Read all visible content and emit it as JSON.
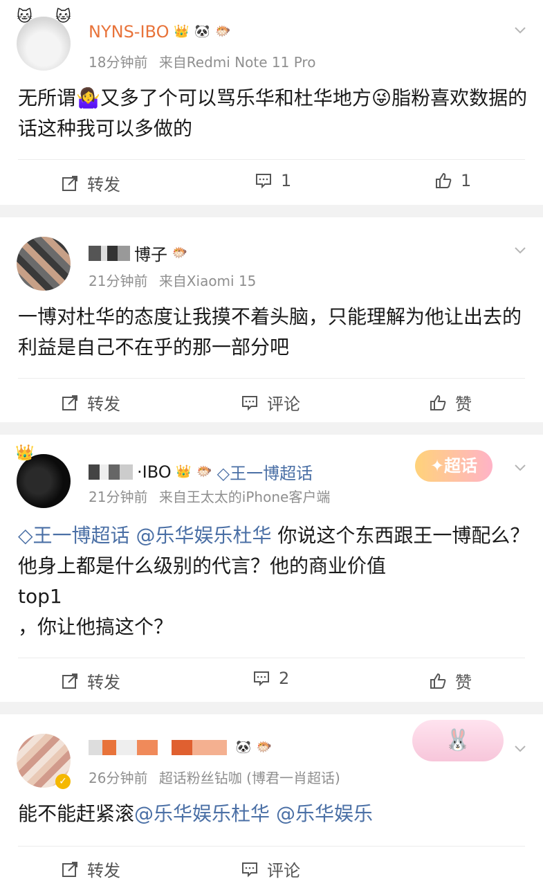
{
  "posts": [
    {
      "username": "NYNS-IBO",
      "time": "18分钟前",
      "source": "来自Redmi Note 11 Pro",
      "text_parts": [
        "无所谓",
        "🤷‍♀️",
        "又多了个可以骂乐华和杜华地方",
        "😜",
        "脂粉喜欢数据的话这种我可以多做的"
      ],
      "actions": {
        "repost": "转发",
        "comment": "1",
        "like": "1"
      }
    },
    {
      "username": "博子",
      "time": "21分钟前",
      "source": "来自Xiaomi 15",
      "text": "一博对杜华的态度让我摸不着头脑，只能理解为他让出去的利益是自己不在乎的那一部分吧",
      "actions": {
        "repost": "转发",
        "comment": "评论",
        "like": "赞"
      }
    },
    {
      "username": "·IBO",
      "topic_tag": "王一博超话",
      "sticker": "超话",
      "time": "21分钟前",
      "source": "来自王太太的iPhone客户端",
      "tag_link": "王一博超话",
      "mention": "@乐华娱乐杜华",
      "text_line1": " 你说这个东西跟王一博配么？ 他身上都是什么级别的代言？他的商业价值",
      "text_line2": "top1",
      "text_line3": "，你让他搞这个？",
      "actions": {
        "repost": "转发",
        "comment": "2",
        "like": "赞"
      }
    },
    {
      "username": "",
      "time": "26分钟前",
      "source": "超话粉丝钻咖 (博君一肖超话)",
      "text": "能不能赶紧滚",
      "mention1": "@乐华娱乐杜华",
      "mention2": "@乐华娱乐",
      "actions": {
        "repost": "转发",
        "comment": "评论"
      }
    }
  ],
  "colors": {
    "link": "#4a6fa5",
    "username": "#e8733a",
    "meta": "#8f8f8f",
    "separator": "#f2f2f2"
  }
}
